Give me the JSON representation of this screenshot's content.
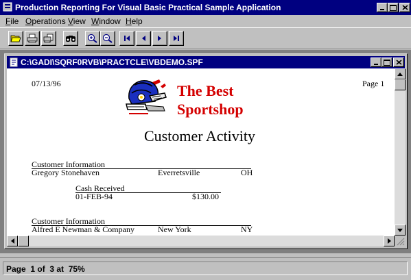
{
  "app": {
    "title": "Production Reporting For Visual Basic Practical Sample Application"
  },
  "menu": [
    {
      "pre": "",
      "accel": "F",
      "post": "ile"
    },
    {
      "pre": "",
      "accel": "O",
      "post": "perations"
    },
    {
      "pre": "",
      "accel": "V",
      "post": "iew"
    },
    {
      "pre": "",
      "accel": "W",
      "post": "indow"
    },
    {
      "pre": "",
      "accel": "H",
      "post": "elp"
    }
  ],
  "toolbar": {
    "buttons": [
      "open-icon",
      "print-icon",
      "print-setup-icon",
      "find-icon",
      "zoom-in-icon",
      "zoom-out-icon",
      "first-page-icon",
      "previous-page-icon",
      "next-page-icon",
      "last-page-icon"
    ]
  },
  "document": {
    "title": "C:\\GADI\\SQRF0RVB\\PRACTCLE\\VBDEMO.SPF",
    "date": "07/13/96",
    "page": "Page 1",
    "logo_line1": "The Best",
    "logo_line2": "Sportshop",
    "report_title": "Customer Activity",
    "section1": {
      "header": "Customer Information",
      "name": "Gregory Stonehaven",
      "city": "Everretsville",
      "state": "OH",
      "cash_header": "Cash Received",
      "cash_date": "01-FEB-94",
      "cash_amount": "$130.00"
    },
    "section2": {
      "header": "Customer Information",
      "name": "Alfred E Newman & Company",
      "city": "New York",
      "state": "NY"
    }
  },
  "status": {
    "text": "Page  1 of  3 at  75%"
  },
  "colors": {
    "titlebar": "#000080",
    "logo_red": "#d40000",
    "helmet_blue": "#1a2fbf"
  }
}
